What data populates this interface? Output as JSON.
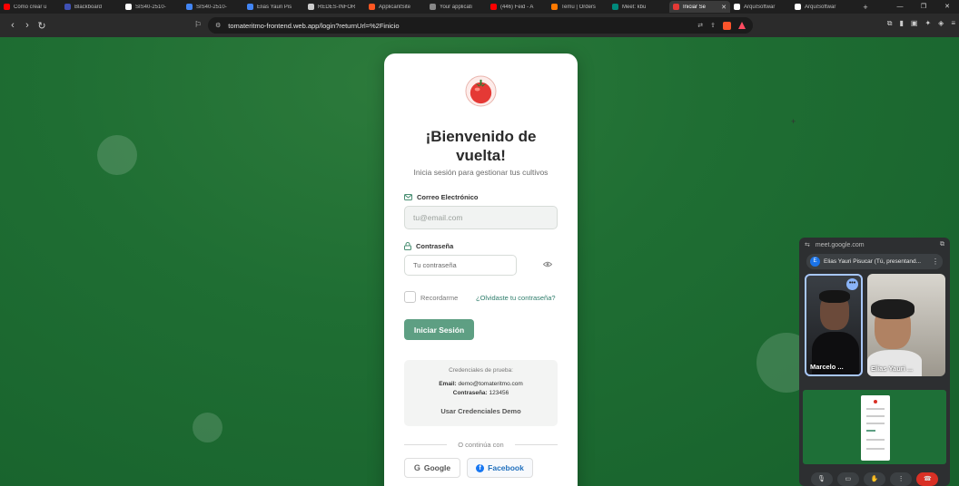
{
  "browser": {
    "tabs": [
      {
        "label": "Cómo crear u",
        "color": "#ff0000"
      },
      {
        "label": "Blackboard",
        "color": "#3f51b5"
      },
      {
        "label": "SIS40-2510-",
        "color": "#ffffff"
      },
      {
        "label": "SIS40-2510-",
        "color": "#4285f4"
      },
      {
        "label": "Elias Yauri Pis",
        "color": "#4285f4"
      },
      {
        "label": "REDES-INFOR",
        "color": "#cccccc"
      },
      {
        "label": "ApplicantSite",
        "color": "#ff5722"
      },
      {
        "label": "Your applicati",
        "color": "#888888"
      },
      {
        "label": "(446) Feid - A",
        "color": "#ff0000"
      },
      {
        "label": "Temu | Orders",
        "color": "#ff7a00"
      },
      {
        "label": "Meet: kbu",
        "color": "#00897b"
      },
      {
        "label": "Iniciar Se",
        "color": "#e53935"
      },
      {
        "label": "ArquiSoftwar",
        "color": "#ffffff"
      },
      {
        "label": "ArquiSoftwar",
        "color": "#ffffff"
      }
    ],
    "active_tab_index": 11,
    "url": "tomateritmo-frontend.web.app/login?returnUrl=%2Finicio",
    "new_tab": "+"
  },
  "login": {
    "title_line1": "¡Bienvenido de",
    "title_line2": "vuelta!",
    "subtitle": "Inicia sesión para gestionar tus cultivos",
    "email_label": "Correo Electrónico",
    "email_placeholder": "tu@email.com",
    "password_label": "Contraseña",
    "password_placeholder": "Tu contraseña",
    "remember_label": "Recordarme",
    "forgot_link": "¿Olvidaste tu contraseña?",
    "submit_label": "Iniciar Sesión",
    "demo": {
      "title": "Credenciales de prueba:",
      "email_label": "Email:",
      "email_value": "demo@tomateritmo.com",
      "password_label": "Contraseña:",
      "password_value": "123456",
      "button_label": "Usar Credenciales Demo"
    },
    "divider_text": "O continúa con",
    "google_label": "Google",
    "facebook_label": "Facebook"
  },
  "meet": {
    "url": "meet.google.com",
    "presenting_initial": "E",
    "presenting_text": "Elias Yauri Pisucar (Tú, presentand...",
    "participants": [
      {
        "name": "Marcelo ..."
      },
      {
        "name": "Elias Yauri ..."
      }
    ]
  },
  "colors": {
    "page_green": "#1f6e33",
    "primary_button": "#5e9f83",
    "link": "#2e7d6b",
    "facebook": "#1877f2"
  }
}
